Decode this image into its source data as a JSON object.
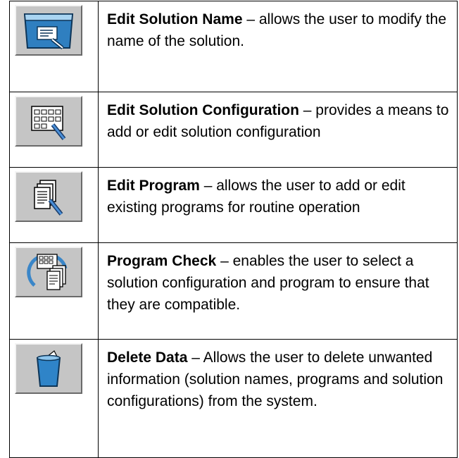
{
  "rows": [
    {
      "icon": "edit-solution-name-icon",
      "title": "Edit Solution Name",
      "description": " – allows the user to modify the name of the solution."
    },
    {
      "icon": "edit-solution-configuration-icon",
      "title": "Edit Solution Configuration",
      "description": " – provides a means to add or edit solution configuration"
    },
    {
      "icon": "edit-program-icon",
      "title": "Edit Program",
      "description": " – allows the user to add or edit existing programs for routine operation"
    },
    {
      "icon": "program-check-icon",
      "title": "Program Check",
      "description": " – enables the user to select a solution configuration and program to ensure that they are compatible."
    },
    {
      "icon": "delete-data-icon",
      "title": "Delete Data",
      "description": " – Allows the user to delete unwanted information (solution names, programs and solution configurations) from the system."
    }
  ]
}
